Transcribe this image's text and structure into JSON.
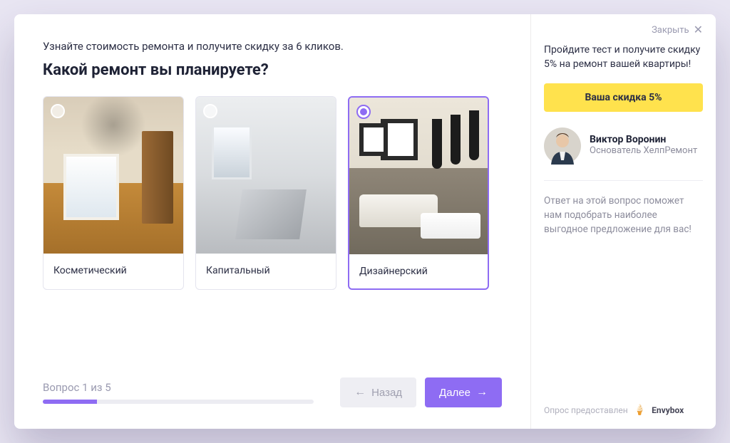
{
  "subtitle": "Узнайте стоимость ремонта и получите скидку за 6 кликов.",
  "title": "Какой ремонт вы планируете?",
  "options": [
    {
      "label": "Косметический",
      "selected": false
    },
    {
      "label": "Капитальный",
      "selected": false
    },
    {
      "label": "Дизайнерский",
      "selected": true
    }
  ],
  "progress": {
    "text": "Вопрос 1 из 5",
    "current": 1,
    "total": 5
  },
  "buttons": {
    "back": "Назад",
    "next": "Далее"
  },
  "sidebar": {
    "close": "Закрыть",
    "headline": "Пройдите тест и получите скидку 5% на ремонт вашей квартиры!",
    "discount_button": "Ваша скидка 5%",
    "person": {
      "name": "Виктор Воронин",
      "role": "Основатель ХелпРемонт"
    },
    "hint": "Ответ на этой вопрос поможет нам подобрать наиболее выгодное предложение для вас!",
    "footer_label": "Опрос предоставлен",
    "brand": "Envybox"
  }
}
